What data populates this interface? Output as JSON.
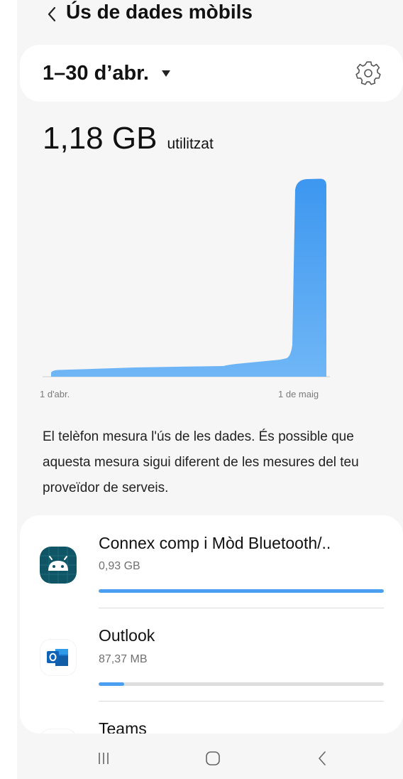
{
  "header": {
    "title": "Ús de dades mòbils",
    "back_icon": "chevron-left-icon"
  },
  "period": {
    "label": "1–30 d’abr.",
    "dropdown_icon": "caret-down-icon",
    "settings_icon": "gear-icon"
  },
  "usage": {
    "value": "1,18 GB",
    "suffix": "utilitzat"
  },
  "chart_data": {
    "type": "area",
    "xlabel_start": "1 d'abr.",
    "xlabel_end": "1 de maig",
    "color": "#4ba0f2"
  },
  "info_text": "El telèfon mesura l'ús de les dades. És possible que aquesta mesura sigui diferent de les mesures del teu proveïdor de serveis.",
  "apps": [
    {
      "name": "Connex comp i Mòd Bluetooth/..",
      "size": "0,93 GB",
      "usage_fraction": 1.0,
      "icon": "android-icon"
    },
    {
      "name": "Outlook",
      "size": "87,37 MB",
      "usage_fraction": 0.09,
      "icon": "outlook-icon"
    },
    {
      "name": "Teams",
      "icon": "teams-icon"
    }
  ],
  "navbar": {
    "recents_icon": "recents-icon",
    "home_icon": "home-icon",
    "back_icon": "back-icon"
  },
  "colors": {
    "accent": "#4b9ff0",
    "background": "#f6f6f6",
    "card": "#ffffff"
  }
}
